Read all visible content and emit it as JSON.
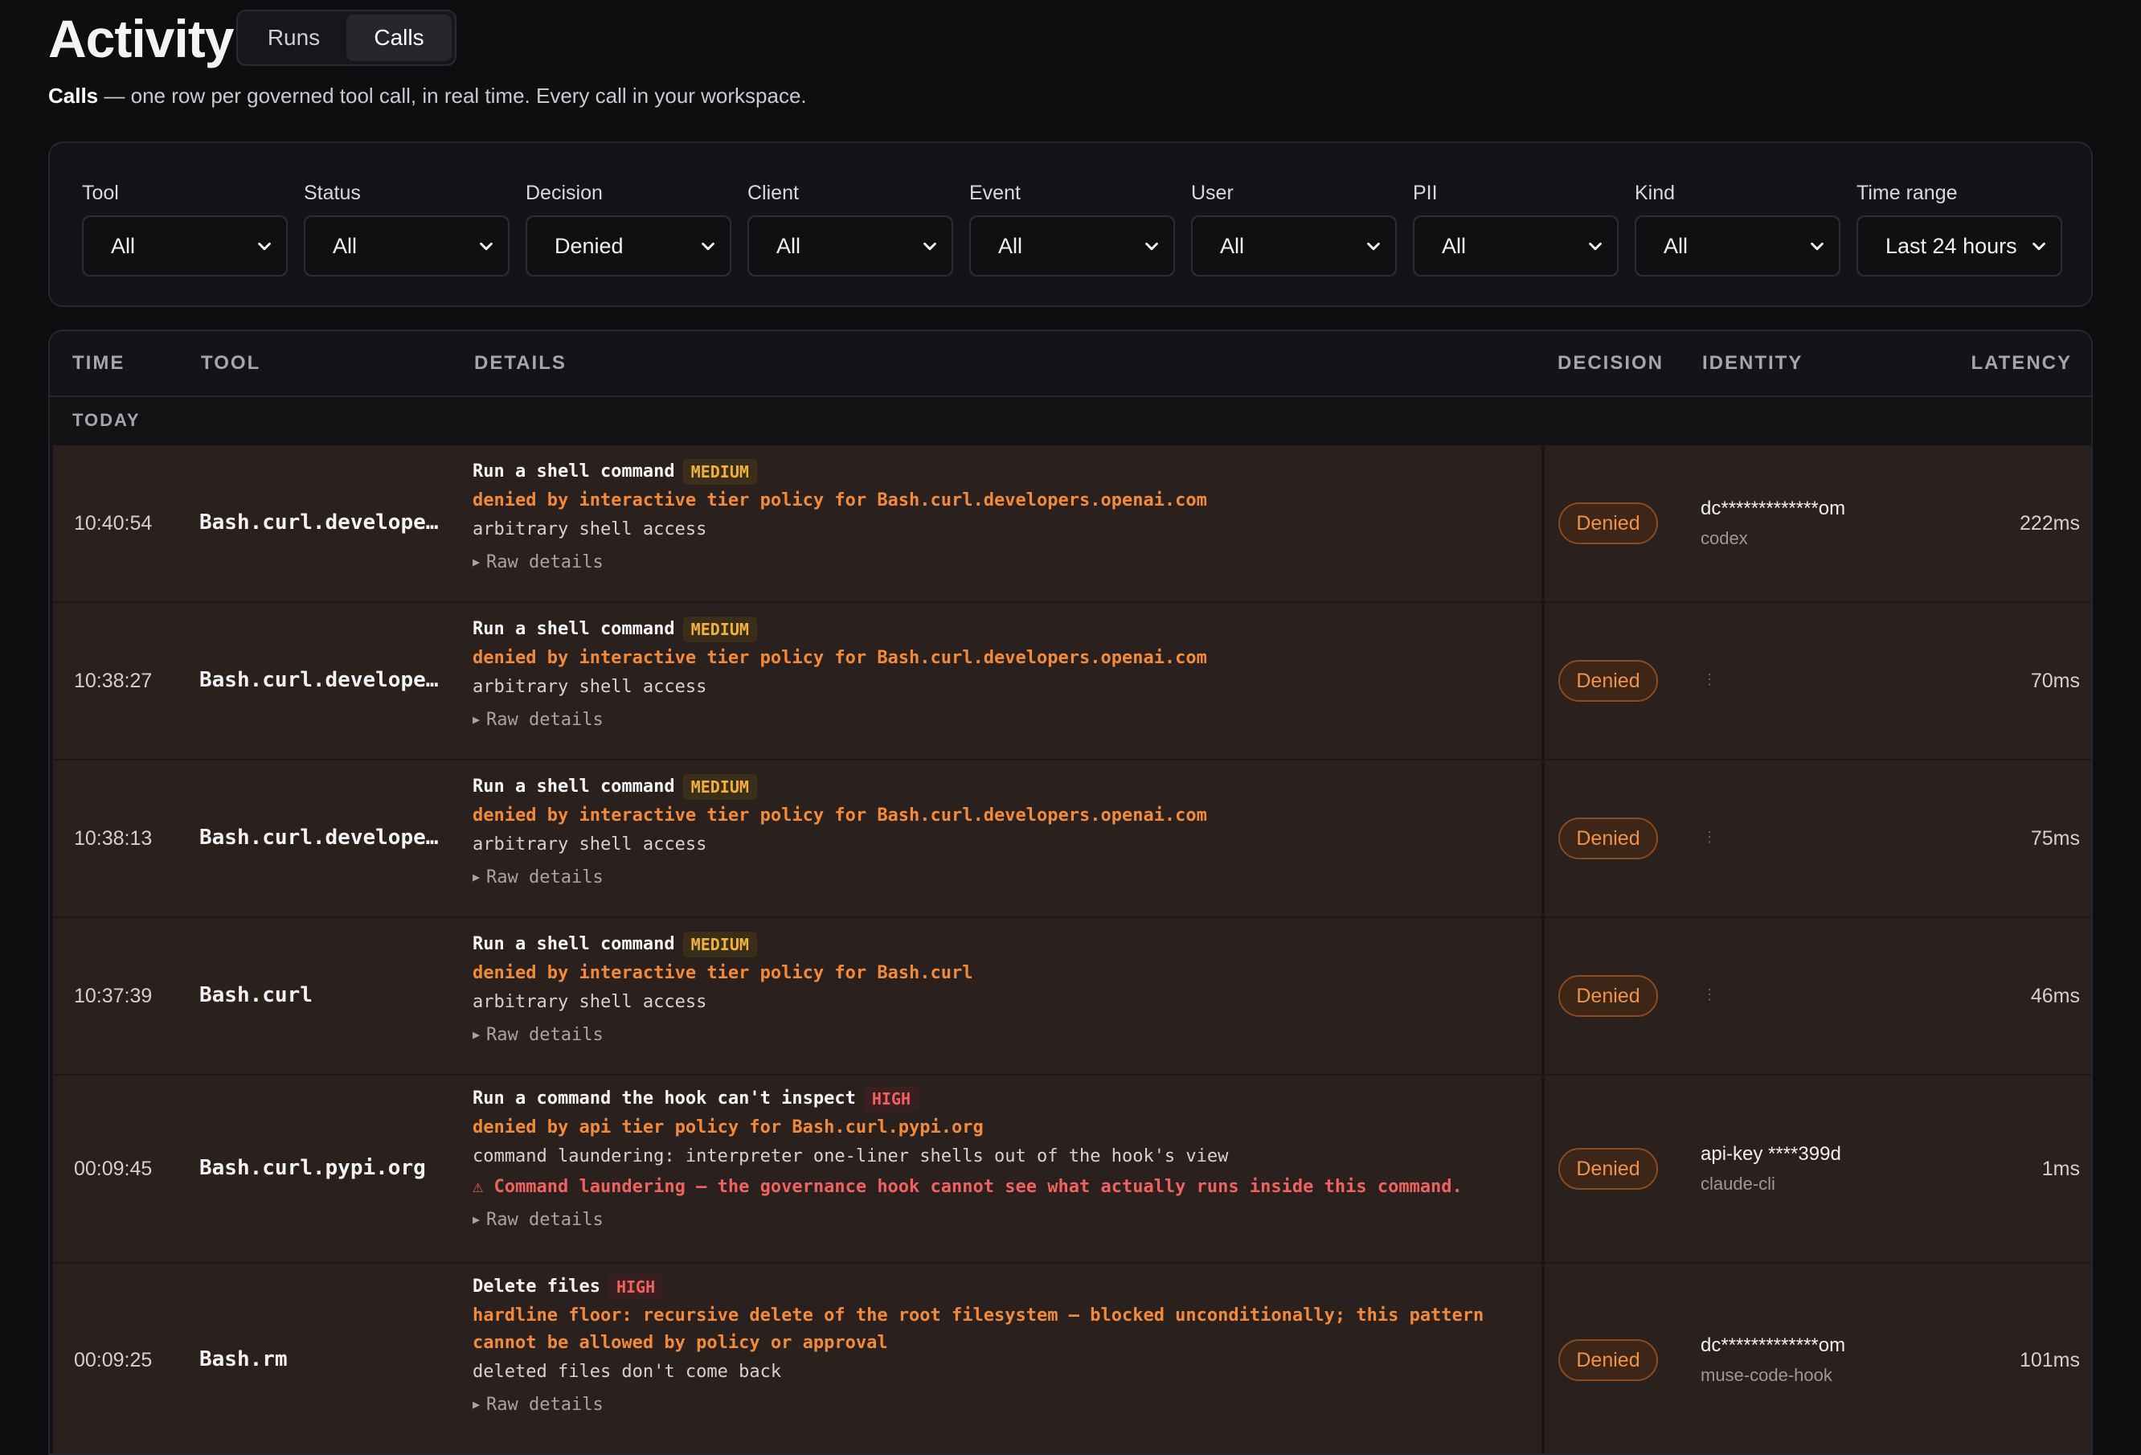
{
  "header": {
    "title": "Activity",
    "tabs": [
      {
        "label": "Runs",
        "active": false
      },
      {
        "label": "Calls",
        "active": true
      }
    ],
    "subtitle_strong": "Calls",
    "subtitle_rest": " — one row per governed tool call, in real time. Every call in your workspace."
  },
  "filters": [
    {
      "label": "Tool",
      "value": "All"
    },
    {
      "label": "Status",
      "value": "All"
    },
    {
      "label": "Decision",
      "value": "Denied"
    },
    {
      "label": "Client",
      "value": "All"
    },
    {
      "label": "Event",
      "value": "All"
    },
    {
      "label": "User",
      "value": "All"
    },
    {
      "label": "PII",
      "value": "All"
    },
    {
      "label": "Kind",
      "value": "All"
    },
    {
      "label": "Time range",
      "value": "Last 24 hours"
    }
  ],
  "table": {
    "columns": {
      "time": "TIME",
      "tool": "TOOL",
      "details": "DETAILS",
      "decision": "DECISION",
      "identity": "IDENTITY",
      "latency": "LATENCY"
    },
    "group_label": "TODAY",
    "raw_label": "Raw details",
    "rows": [
      {
        "time": "10:40:54",
        "tool": "Bash.curl.developers.openai.com",
        "title": "Run a shell command",
        "tier": "MEDIUM",
        "reason": "denied by interactive tier policy for Bash.curl.developers.openai.com",
        "reason2": "",
        "note": "arbitrary shell access",
        "warning": "",
        "decision": "Denied",
        "identity": "dc*************om",
        "client": "codex",
        "latency": "222ms"
      },
      {
        "time": "10:38:27",
        "tool": "Bash.curl.developers.openai.com",
        "title": "Run a shell command",
        "tier": "MEDIUM",
        "reason": "denied by interactive tier policy for Bash.curl.developers.openai.com",
        "reason2": "",
        "note": "arbitrary shell access",
        "warning": "",
        "decision": "Denied",
        "identity": "",
        "client": "",
        "latency": "70ms"
      },
      {
        "time": "10:38:13",
        "tool": "Bash.curl.developers.openai.com",
        "title": "Run a shell command",
        "tier": "MEDIUM",
        "reason": "denied by interactive tier policy for Bash.curl.developers.openai.com",
        "reason2": "",
        "note": "arbitrary shell access",
        "warning": "",
        "decision": "Denied",
        "identity": "",
        "client": "",
        "latency": "75ms"
      },
      {
        "time": "10:37:39",
        "tool": "Bash.curl",
        "title": "Run a shell command",
        "tier": "MEDIUM",
        "reason": "denied by interactive tier policy for Bash.curl",
        "reason2": "",
        "note": "arbitrary shell access",
        "warning": "",
        "decision": "Denied",
        "identity": "",
        "client": "",
        "latency": "46ms"
      },
      {
        "time": "00:09:45",
        "tool": "Bash.curl.pypi.org",
        "title": "Run a command the hook can't inspect",
        "tier": "HIGH",
        "reason": "denied by api tier policy for Bash.curl.pypi.org",
        "reason2": "",
        "note": "command laundering: interpreter one-liner shells out of the hook's view",
        "warning": "⚠ Command laundering — the governance hook cannot see what actually runs inside this command.",
        "decision": "Denied",
        "identity": "api-key ****399d",
        "client": "claude-cli",
        "latency": "1ms"
      },
      {
        "time": "00:09:25",
        "tool": "Bash.rm",
        "title": "Delete files",
        "tier": "HIGH",
        "reason": "hardline floor: recursive delete of the root filesystem — blocked unconditionally; this pattern",
        "reason2": "cannot be allowed by policy or approval",
        "note": "deleted files don't come back",
        "warning": "",
        "decision": "Denied",
        "identity": "dc*************om",
        "client": "muse-code-hook",
        "latency": "101ms"
      }
    ]
  },
  "colors": {
    "accent_denied": "#f19248",
    "tier_medium": "#f1b13b",
    "tier_high": "#f0625f"
  }
}
